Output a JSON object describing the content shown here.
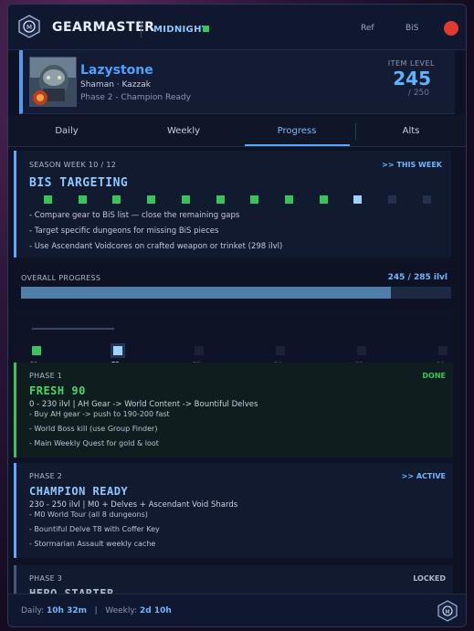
{
  "header": {
    "app_name": "GEARMASTER",
    "season": "MIDNIGHT",
    "ref_label": "Ref",
    "bis_label": "BiS"
  },
  "character": {
    "name": "Lazystone",
    "class_realm": "Shaman  ·  Kazzak",
    "phase_status": "Phase 2  -  Champion Ready",
    "item_level_label": "ITEM LEVEL",
    "item_level": "245",
    "item_level_max": "/ 250"
  },
  "tabs": [
    {
      "label": "Daily"
    },
    {
      "label": "Weekly"
    },
    {
      "label": "Progress"
    },
    {
      "label": "Alts"
    }
  ],
  "bis_card": {
    "week_label": "SEASON WEEK  10 / 12",
    "this_week": ">> THIS WEEK",
    "title": "BIS TARGETING",
    "weeks_done": 9,
    "current_week": 10,
    "total_weeks": 12,
    "lines": [
      "- Compare gear to BiS list — close the remaining gaps",
      "- Target specific dungeons for missing BiS pieces",
      "- Use Ascendant Voidcores on crafted weapon or trinket (298 ilvl)"
    ]
  },
  "overall": {
    "label": "OVERALL PROGRESS",
    "value_text": "245 / 285 ilvl",
    "current": 245,
    "target": 285
  },
  "phase_track": {
    "labels": [
      "P1",
      "P2",
      "P3",
      "P4",
      "P5",
      "P6"
    ],
    "current_index": 1
  },
  "phases": [
    {
      "tag": "PHASE 1",
      "status": "DONE",
      "title": "FRESH 90",
      "range": "0 - 230 ilvl  |  AH Gear -> World Content -> Bountiful Delves",
      "lines": [
        "- Buy AH gear -> push to 190-200 fast",
        "- World Boss kill (use Group Finder)",
        "- Main Weekly Quest for gold & loot"
      ]
    },
    {
      "tag": "PHASE 2",
      "status": ">> ACTIVE",
      "title": "CHAMPION READY",
      "range": "230 - 250 ilvl  |  M0 + Delves + Ascendant Void Shards",
      "lines": [
        "- M0 World Tour (all 8 dungeons)",
        "- Bountiful Delve T8 with Coffer Key",
        "- Stormarian Assault weekly cache"
      ]
    },
    {
      "tag": "PHASE 3",
      "status": "LOCKED",
      "title": "HERO STARTER"
    }
  ],
  "footer": {
    "daily_label": "Daily:",
    "daily_value": "10h 32m",
    "weekly_label": "Weekly:",
    "weekly_value": "2d 10h"
  },
  "colors": {
    "accent": "#5fa6ff",
    "done": "#37c45a",
    "record": "#e23a2e"
  }
}
